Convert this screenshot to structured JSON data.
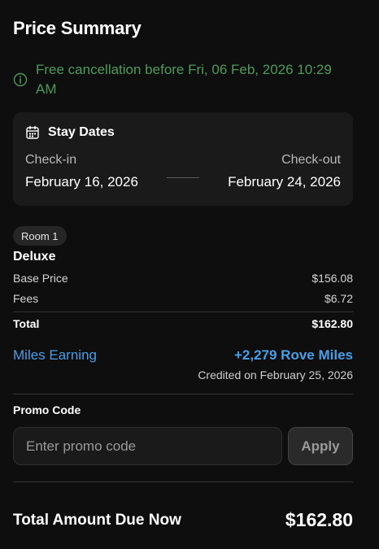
{
  "header": {
    "title": "Price Summary"
  },
  "cancellation": {
    "text": "Free cancellation before Fri, 06 Feb, 2026 10:29 AM",
    "icon": "info-icon",
    "color": "#4f9a5c"
  },
  "stay_dates": {
    "heading": "Stay Dates",
    "icon": "calendar-icon",
    "check_in_label": "Check-in",
    "check_in_value": "February 16, 2026",
    "check_out_label": "Check-out",
    "check_out_value": "February 24, 2026"
  },
  "room": {
    "badge": "Room 1",
    "name": "Deluxe",
    "base_price_label": "Base Price",
    "base_price_value": "$156.08",
    "fees_label": "Fees",
    "fees_value": "$6.72",
    "total_label": "Total",
    "total_value": "$162.80"
  },
  "miles": {
    "label": "Miles Earning",
    "value": "+2,279 Rove Miles",
    "note": "Credited on February 25, 2026",
    "color": "#4b9ee8"
  },
  "promo": {
    "label": "Promo Code",
    "placeholder": "Enter promo code",
    "value": "",
    "apply_label": "Apply"
  },
  "total_due": {
    "label": "Total Amount Due Now",
    "value": "$162.80"
  }
}
